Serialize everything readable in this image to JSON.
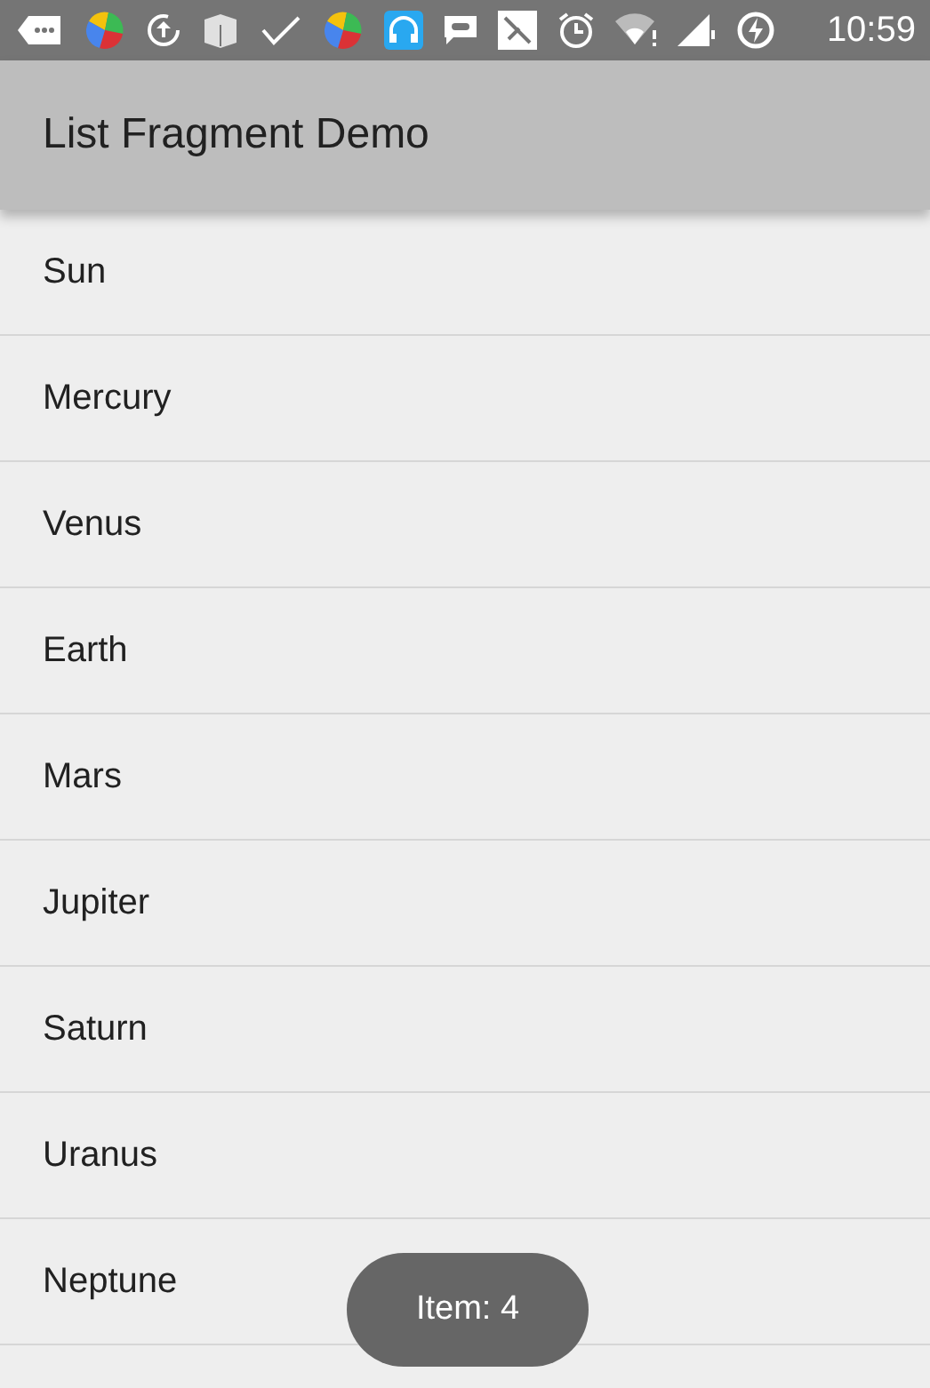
{
  "status_bar": {
    "time": "10:59"
  },
  "app_bar": {
    "title": "List Fragment Demo"
  },
  "list": {
    "items": [
      {
        "label": "Sun"
      },
      {
        "label": "Mercury"
      },
      {
        "label": "Venus"
      },
      {
        "label": "Earth"
      },
      {
        "label": "Mars"
      },
      {
        "label": "Jupiter"
      },
      {
        "label": "Saturn"
      },
      {
        "label": "Uranus"
      },
      {
        "label": "Neptune"
      }
    ]
  },
  "toast": {
    "text": "Item: 4"
  }
}
